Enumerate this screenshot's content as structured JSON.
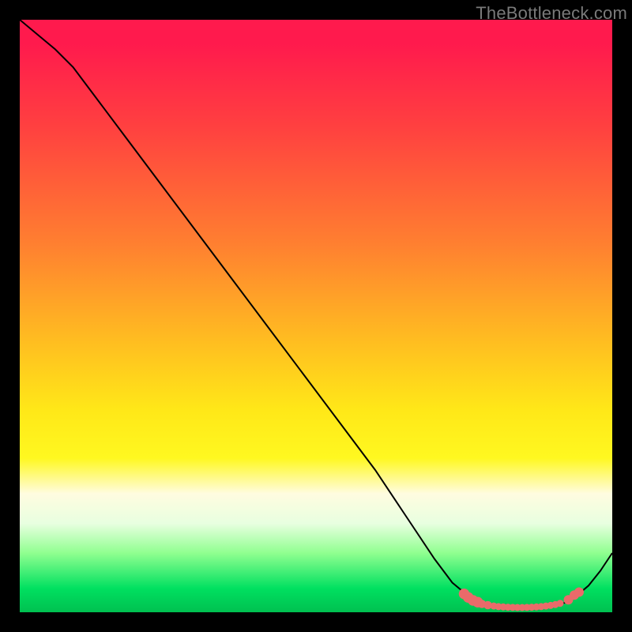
{
  "watermark": "TheBottleneck.com",
  "colors": {
    "curve": "#000000",
    "dots": "#ea6a6a"
  },
  "chart_data": {
    "type": "line",
    "title": "",
    "xlabel": "",
    "ylabel": "",
    "xlim": [
      0,
      100
    ],
    "ylim": [
      0,
      100
    ],
    "grid": false,
    "legend": false,
    "series": [
      {
        "name": "curve",
        "x": [
          0,
          3,
          6,
          9,
          12,
          18,
          24,
          30,
          36,
          42,
          48,
          54,
          60,
          66,
          70,
          73,
          76,
          78,
          80,
          82,
          84,
          86,
          88,
          90,
          92,
          94,
          96,
          98,
          100
        ],
        "y": [
          100,
          97.5,
          95,
          92,
          88,
          80,
          72,
          64,
          56,
          48,
          40,
          32,
          24,
          15,
          9,
          5,
          2.5,
          1.6,
          1.1,
          0.9,
          0.8,
          0.8,
          0.9,
          1.1,
          1.6,
          2.8,
          4.5,
          7,
          10
        ]
      }
    ],
    "markers": [
      {
        "x": 75.0,
        "y": 3.1,
        "r": 0.9
      },
      {
        "x": 75.7,
        "y": 2.5,
        "r": 0.9
      },
      {
        "x": 76.5,
        "y": 2.0,
        "r": 0.9
      },
      {
        "x": 77.3,
        "y": 1.7,
        "r": 0.9
      },
      {
        "x": 78.0,
        "y": 1.4,
        "r": 0.7
      },
      {
        "x": 79.0,
        "y": 1.2,
        "r": 0.7
      },
      {
        "x": 80.0,
        "y": 1.05,
        "r": 0.6
      },
      {
        "x": 80.8,
        "y": 0.95,
        "r": 0.6
      },
      {
        "x": 81.6,
        "y": 0.9,
        "r": 0.6
      },
      {
        "x": 82.4,
        "y": 0.85,
        "r": 0.6
      },
      {
        "x": 83.2,
        "y": 0.82,
        "r": 0.6
      },
      {
        "x": 84.0,
        "y": 0.8,
        "r": 0.6
      },
      {
        "x": 84.8,
        "y": 0.8,
        "r": 0.6
      },
      {
        "x": 85.6,
        "y": 0.82,
        "r": 0.6
      },
      {
        "x": 86.4,
        "y": 0.85,
        "r": 0.6
      },
      {
        "x": 87.2,
        "y": 0.9,
        "r": 0.6
      },
      {
        "x": 88.0,
        "y": 0.95,
        "r": 0.6
      },
      {
        "x": 88.8,
        "y": 1.05,
        "r": 0.6
      },
      {
        "x": 89.6,
        "y": 1.15,
        "r": 0.6
      },
      {
        "x": 90.4,
        "y": 1.3,
        "r": 0.6
      },
      {
        "x": 91.2,
        "y": 1.5,
        "r": 0.6
      },
      {
        "x": 92.6,
        "y": 2.1,
        "r": 0.8
      },
      {
        "x": 93.6,
        "y": 2.9,
        "r": 0.8
      },
      {
        "x": 94.4,
        "y": 3.4,
        "r": 0.8
      }
    ]
  }
}
